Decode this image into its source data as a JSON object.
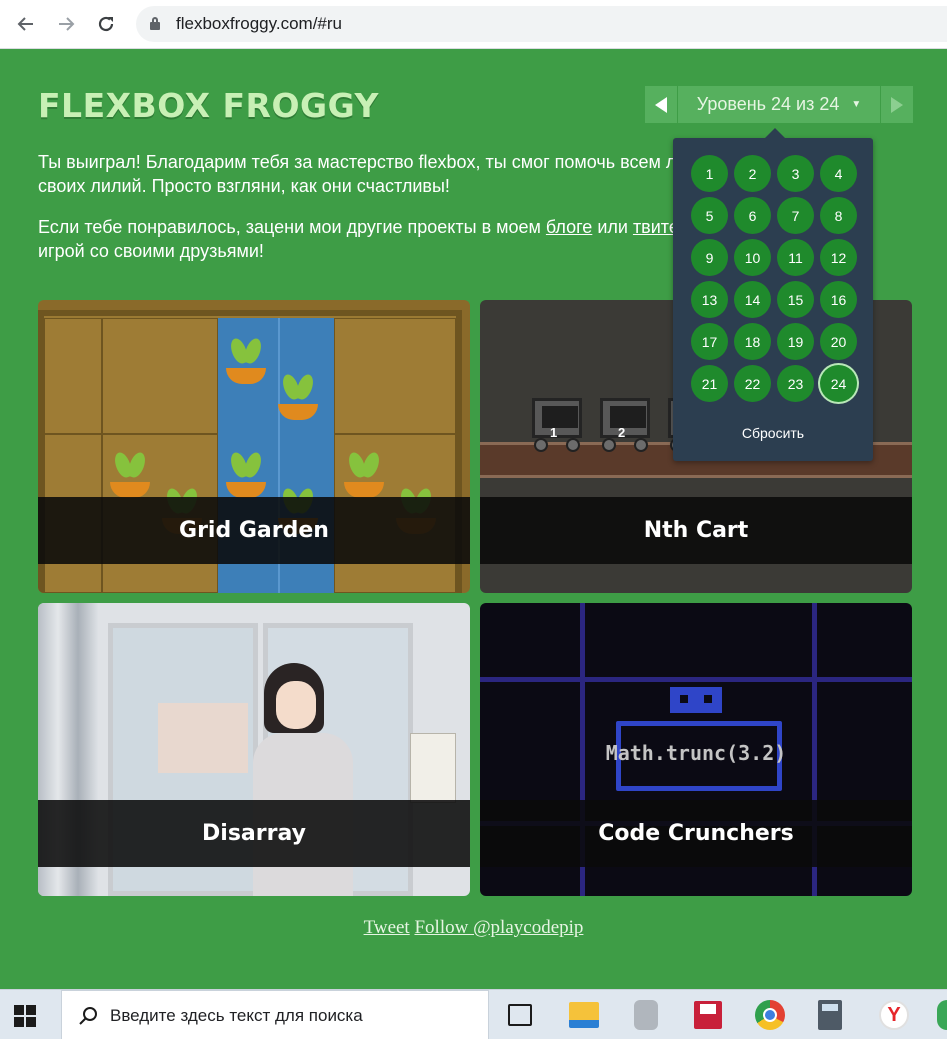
{
  "browser": {
    "url": "flexboxfroggy.com/#ru"
  },
  "header": {
    "logo": "FLEXBOX FROGGY",
    "level_indicator": "Уровень 24 из 24"
  },
  "victory": {
    "part1": "Ты выиграл! Благодарим тебя за мастерство flexbox, ты смог помочь всем лягушкам добраться до своих лилий. Просто взгляни, как они счастливы!",
    "part2_before": "Если тебе понравилось, зацени мои другие проекты в моем ",
    "blog_link": "блоге",
    "part2_middle": " или ",
    "twitter_link": "твитере",
    "part2_after": ", и поделись этой игрой со своими друзьями!"
  },
  "level_menu": {
    "levels": [
      "1",
      "2",
      "3",
      "4",
      "5",
      "6",
      "7",
      "8",
      "9",
      "10",
      "11",
      "12",
      "13",
      "14",
      "15",
      "16",
      "17",
      "18",
      "19",
      "20",
      "21",
      "22",
      "23",
      "24"
    ],
    "current": "24",
    "reset_label": "Сбросить"
  },
  "games": [
    {
      "title": "Grid Garden"
    },
    {
      "title": "Nth Cart"
    },
    {
      "title": "Disarray"
    },
    {
      "title": "Code Crunchers",
      "code": "Math.trunc(3.2)"
    }
  ],
  "footer": {
    "tweet": "Tweet",
    "follow": "Follow @playcodepip"
  },
  "taskbar": {
    "search_placeholder": "Введите здесь текст для поиска"
  },
  "colors": {
    "page_bg": "#3e9d46",
    "logo": "#c8f0b5",
    "level_nav": "#56b05e",
    "menu_bg": "#2c3e50",
    "level_dot": "#1f8a2c"
  }
}
